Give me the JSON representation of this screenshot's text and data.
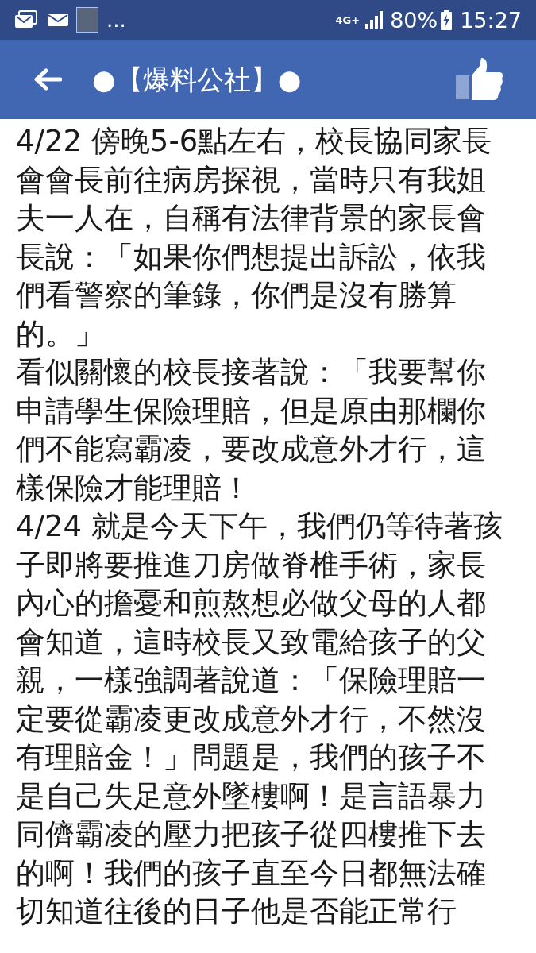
{
  "status_bar": {
    "more": "...",
    "network": "4G+",
    "battery": "80%",
    "time": "15:27"
  },
  "header": {
    "title": "●【爆料公社】●"
  },
  "post": {
    "lines": [
      "4/22 傍晚5-6點左右，校長協同家長",
      "會會長前往病房探視，當時只有我姐",
      "夫一人在，自稱有法律背景的家長會",
      "長說：「如果你們想提出訴訟，依我",
      "們看警察的筆錄，你們是沒有勝算",
      "的。」",
      "看似關懷的校長接著說：「我要幫你",
      "申請學生保險理賠，但是原由那欄你",
      "們不能寫霸凌，要改成意外才行，這",
      "樣保險才能理賠！",
      "4/24 就是今天下午，我們仍等待著孩",
      "子即將要推進刀房做脊椎手術，家長",
      "內心的擔憂和煎熬想必做父母的人都",
      "會知道，這時校長又致電給孩子的父",
      "親，一樣強調著說道：「保險理賠一",
      "定要從霸凌更改成意外才行，不然沒",
      "有理賠金！」問題是，我們的孩子不",
      "是自己失足意外墜樓啊！是言語暴力",
      "同儕霸凌的壓力把孩子從四樓推下去",
      "的啊！我們的孩子直至今日都無法確",
      "切知道往後的日子他是否能正常行"
    ]
  }
}
